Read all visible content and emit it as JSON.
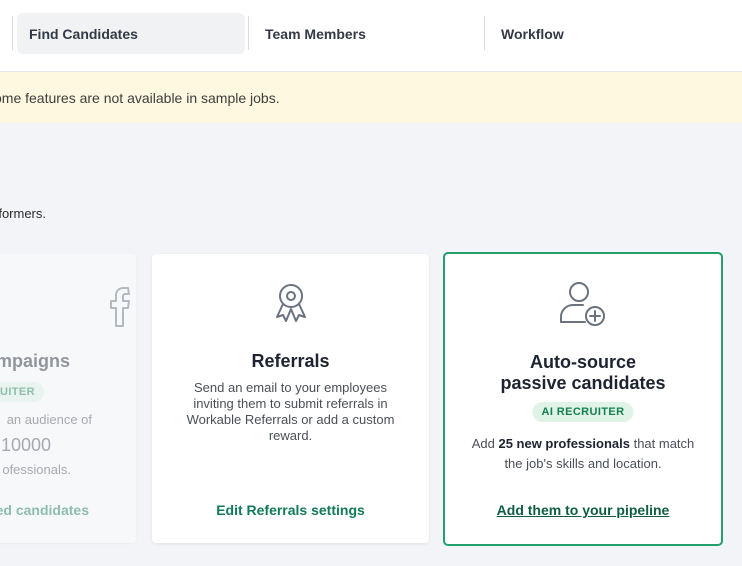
{
  "tabs": [
    {
      "label": "Find Candidates",
      "active": true
    },
    {
      "label": "Team Members",
      "active": false
    },
    {
      "label": "Workflow",
      "active": false
    }
  ],
  "banner": {
    "text": "ome features are not available in sample jobs."
  },
  "intro": {
    "text": "rformers."
  },
  "cards": {
    "campaigns": {
      "title": "mpaigns",
      "badge": "RUITER",
      "line1": "an audience of",
      "number": "10000",
      "line2": "ofessionals.",
      "action": "ed candidates"
    },
    "referrals": {
      "icon": "award-ribbon-icon",
      "title": "Referrals",
      "body": "Send an email to your employees inviting them to submit referrals in Workable Referrals or add a custom reward.",
      "action": "Edit Referrals settings"
    },
    "autosource": {
      "icon": "add-user-icon",
      "title_line1": "Auto-source",
      "title_line2": "passive candidates",
      "badge": "AI RECRUITER",
      "body_pre": "Add ",
      "body_bold": "25 new professionals",
      "body_post": " that match the job's skills and location.",
      "action": "Add them to your pipeline"
    }
  },
  "colors": {
    "accent_green": "#21a06b",
    "banner_bg": "#fff8e0",
    "badge_bg": "#dff3e6",
    "link_green": "#117a58"
  }
}
